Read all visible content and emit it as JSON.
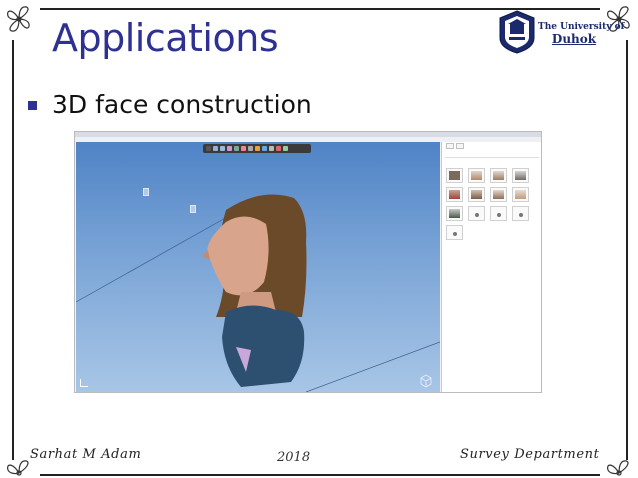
{
  "slide": {
    "title": "Applications",
    "bullet": "3D face construction"
  },
  "logo": {
    "line1": "The University of",
    "line2": "Duhok"
  },
  "footer": {
    "author": "Sarhat M Adam",
    "year": "2018",
    "department": "Survey Department"
  },
  "colors": {
    "title": "#2e3192",
    "viewport_top": "#4f83c6",
    "viewport_bottom": "#a8c6e6"
  },
  "app": {
    "side_panel": {
      "thumbnail_count": 13
    }
  }
}
